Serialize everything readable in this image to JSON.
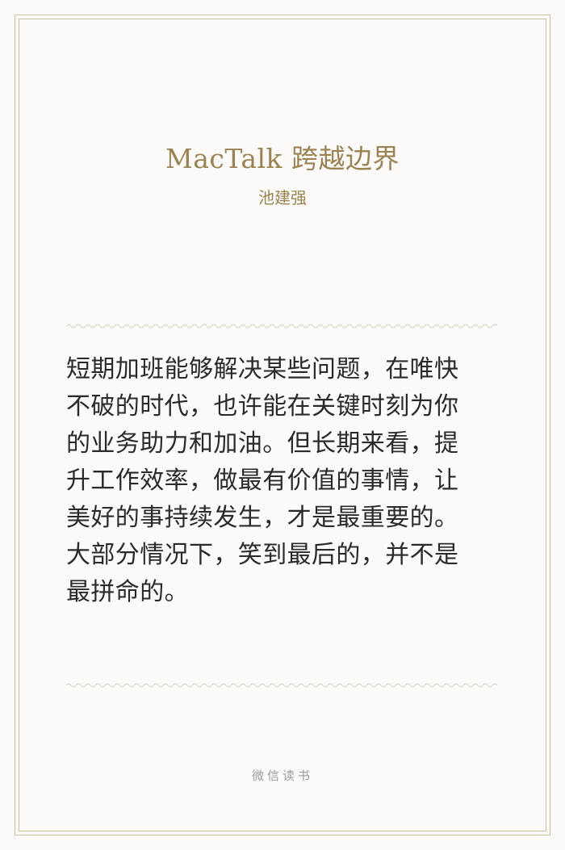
{
  "card": {
    "book_title": "MacTalk 跨越边界",
    "author": "池建强",
    "quote_lines": [
      "短期加班能够解决某些问题，在唯快",
      "不破的时代，也许能在关键时刻为你",
      "的业务助力和加油。但长期来看，提",
      "升工作效率，做最有价值的事情，让",
      "美好的事持续发生，才是最重要的。",
      "大部分情况下，笑到最后的，并不是",
      "最拼命的。"
    ],
    "footer_brand": "微信读书"
  },
  "colors": {
    "background": "#fbfaf8",
    "accent_gold": "#9a8350",
    "frame": "#cbbf9e",
    "text": "#2a2a2a",
    "footer": "#9c9c9c"
  }
}
